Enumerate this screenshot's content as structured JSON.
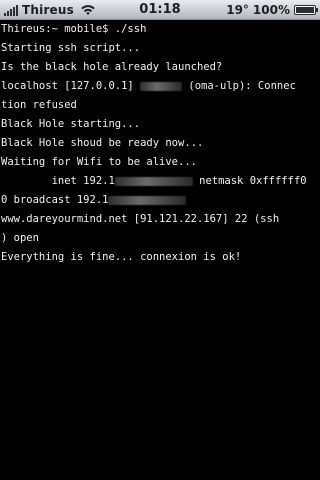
{
  "status_bar": {
    "carrier": "Thireus",
    "time": "01:18",
    "temperature": "19°",
    "battery_percent": "100%",
    "battery_level": 1.0,
    "signal_bars": 5,
    "icons": [
      "signal-bars-icon",
      "wifi-icon",
      "battery-icon"
    ]
  },
  "terminal": {
    "prompt": "Thireus:~ mobile$ ./ssh",
    "lines": [
      "Starting ssh script...",
      "Is the black hole already launched?",
      {
        "before": "localhost [127.0.0.1] ",
        "after": " (oma-ulp): Connec"
      },
      "tion refused",
      "Black Hole starting...",
      "Black Hole shoud be ready now...",
      "Waiting for Wifi to be alive...",
      {
        "before": "        inet 192.1",
        "after": " netmask 0xffffff0"
      },
      {
        "before": "0 broadcast 192.1",
        "after": ""
      },
      "www.dareyourmind.net [91.121.22.167] 22 (ssh",
      ") open",
      "Everything is fine... connexion is ok!"
    ]
  }
}
